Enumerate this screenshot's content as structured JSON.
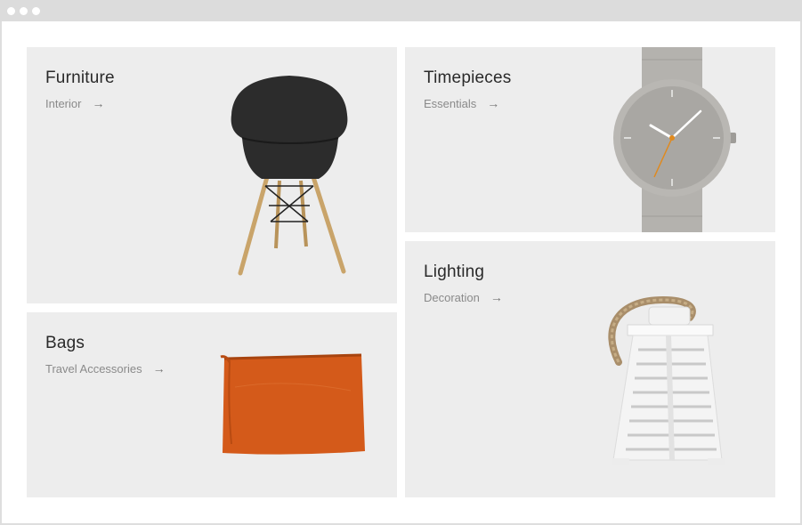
{
  "window": {
    "controls": [
      "dot",
      "dot",
      "dot"
    ]
  },
  "cards": [
    {
      "id": "furniture",
      "title": "Furniture",
      "link_label": "Interior",
      "arrow": "→",
      "icon": "chair-image"
    },
    {
      "id": "timepieces",
      "title": "Timepieces",
      "link_label": "Essentials",
      "arrow": "→",
      "icon": "watch-image"
    },
    {
      "id": "bags",
      "title": "Bags",
      "link_label": "Travel Accessories",
      "arrow": "→",
      "icon": "clutch-bag-image"
    },
    {
      "id": "lighting",
      "title": "Lighting",
      "link_label": "Decoration",
      "arrow": "→",
      "icon": "lantern-image"
    }
  ],
  "colors": {
    "card_background": "#ededed",
    "title_text": "#2a2a2a",
    "link_text": "#8a8a8a",
    "bag_orange": "#d45a1a",
    "watch_grey": "#a9a7a3",
    "watch_second_hand": "#e08a1e"
  }
}
